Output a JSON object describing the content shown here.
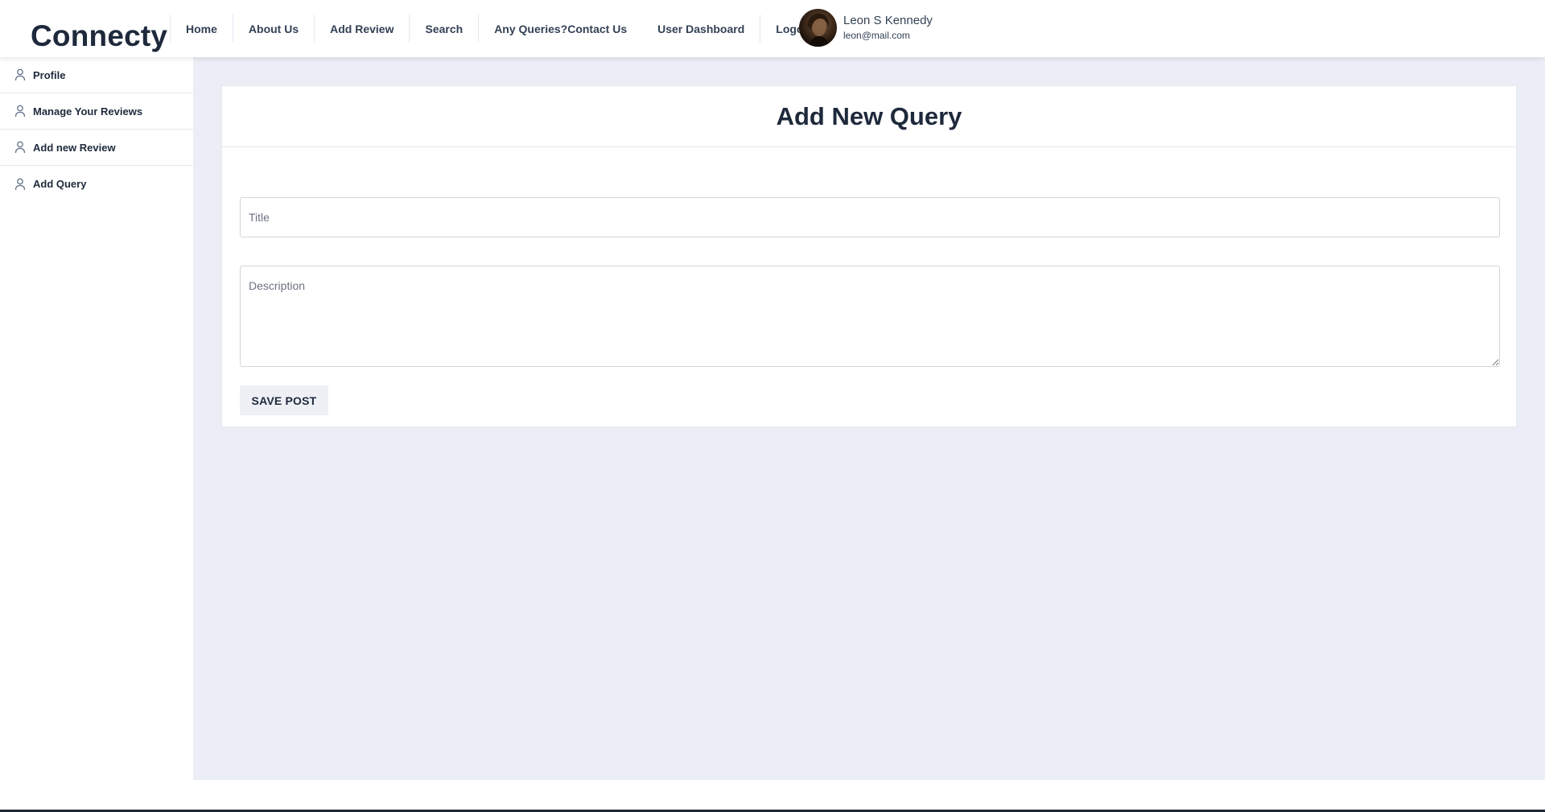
{
  "brand": {
    "name": "Connecty"
  },
  "nav": {
    "items": [
      {
        "label": "Home"
      },
      {
        "label": "About Us"
      },
      {
        "label": "Add Review"
      },
      {
        "label": "Search"
      },
      {
        "label": "Any Queries?Contact Us"
      },
      {
        "label": "User Dashboard"
      },
      {
        "label": "Logout"
      }
    ]
  },
  "user": {
    "name": "Leon S Kennedy",
    "email": "leon@mail.com"
  },
  "sidebar": {
    "items": [
      {
        "label": "Profile",
        "icon": "user-icon"
      },
      {
        "label": "Manage Your Reviews",
        "icon": "user-icon"
      },
      {
        "label": "Add new Review",
        "icon": "user-icon"
      },
      {
        "label": "Add Query",
        "icon": "user-icon"
      }
    ]
  },
  "form": {
    "heading": "Add New Query",
    "title_placeholder": "Title",
    "title_value": "",
    "description_placeholder": "Description",
    "description_value": "",
    "save_label": "SAVE POST"
  },
  "colors": {
    "page_background": "#ebeef6",
    "text_dark": "#1e293b",
    "button_background": "#eef0f6"
  }
}
